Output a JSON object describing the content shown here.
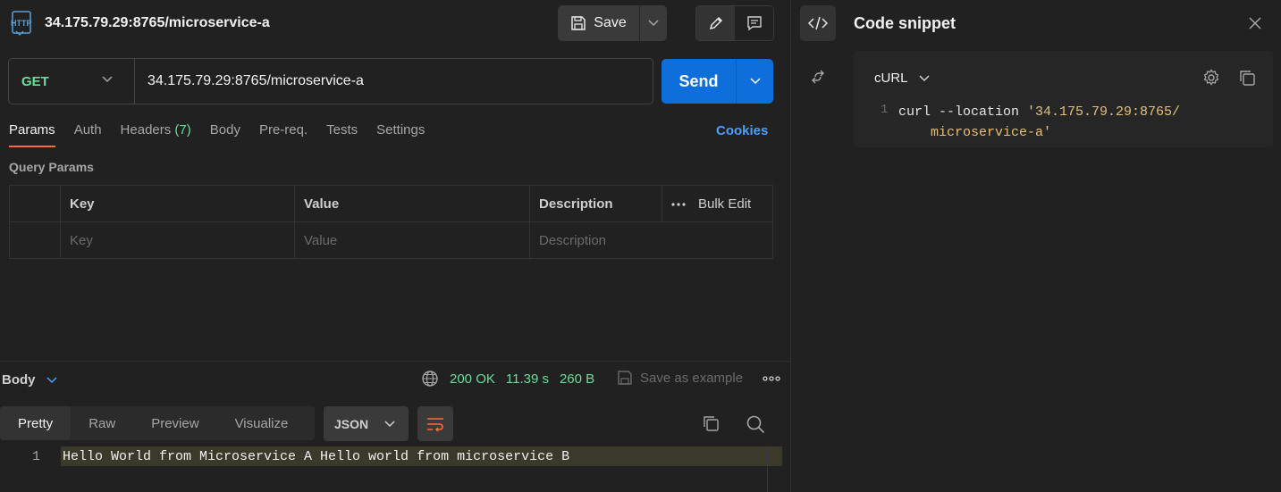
{
  "request": {
    "icon": "http-icon",
    "title": "34.175.79.29:8765/microservice-a",
    "save_label": "Save",
    "method": "GET",
    "url": "34.175.79.29:8765/microservice-a",
    "send_label": "Send"
  },
  "tabs": {
    "params": "Params",
    "auth": "Auth",
    "headers": "Headers",
    "headers_count": "(7)",
    "body": "Body",
    "prereq": "Pre-req.",
    "tests": "Tests",
    "settings": "Settings",
    "cookies": "Cookies"
  },
  "query_params": {
    "title": "Query Params",
    "columns": {
      "key": "Key",
      "value": "Value",
      "description": "Description",
      "bulk_edit": "Bulk Edit"
    },
    "placeholders": {
      "key": "Key",
      "value": "Value",
      "description": "Description"
    }
  },
  "response": {
    "label": "Body",
    "status": "200 OK",
    "time": "11.39 s",
    "size": "260 B",
    "save_example": "Save as example",
    "views": [
      "Pretty",
      "Raw",
      "Preview",
      "Visualize"
    ],
    "active_view": "Pretty",
    "format": "JSON",
    "lines": [
      {
        "number": "1",
        "text": "Hello World from Microservice A Hello world from microservice B"
      }
    ]
  },
  "snippet": {
    "title": "Code snippet",
    "language": "cURL",
    "line_number": "1",
    "code_cmd": "curl --location ",
    "code_str_1": "'34.175.79.29:8765/",
    "code_str_2": "microservice-a'"
  },
  "colors": {
    "background": "#212121",
    "accent_send": "#0e6fda",
    "status_ok": "#6bdd9a",
    "tab_underline": "#ff6c37",
    "link": "#4d9fff",
    "string": "#e5c07b"
  }
}
